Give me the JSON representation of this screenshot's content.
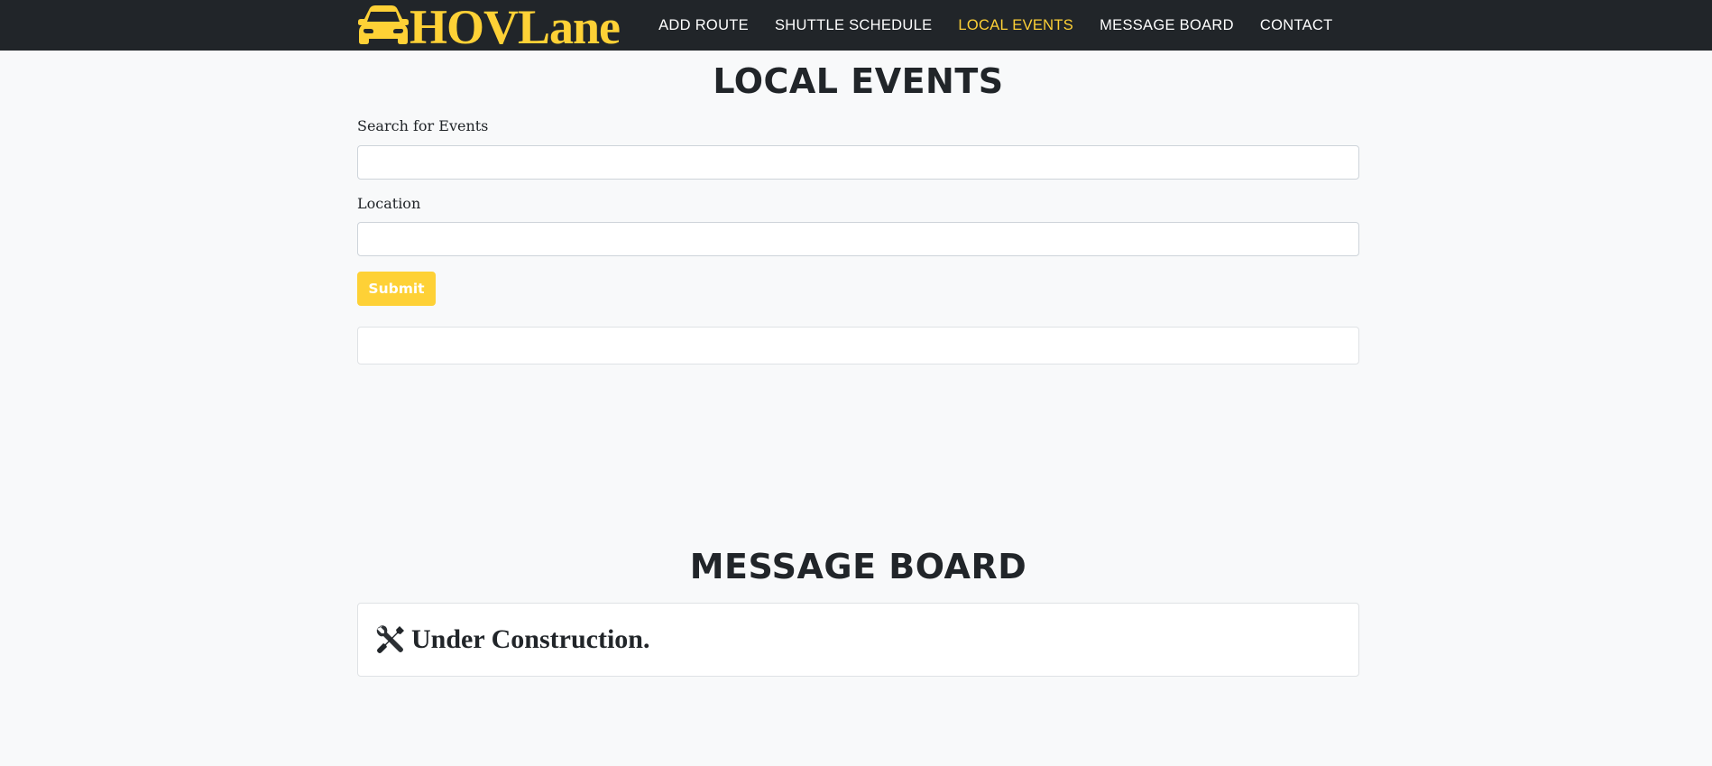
{
  "brand": {
    "name": "HOVLane",
    "icon": "car-icon",
    "color": "#fed136"
  },
  "nav": {
    "items": [
      {
        "label": "ADD ROUTE",
        "active": false
      },
      {
        "label": "SHUTTLE SCHEDULE",
        "active": false
      },
      {
        "label": "LOCAL EVENTS",
        "active": true
      },
      {
        "label": "MESSAGE BOARD",
        "active": false
      },
      {
        "label": "CONTACT",
        "active": false
      }
    ]
  },
  "events": {
    "title": "LOCAL EVENTS",
    "search_label": "Search for Events",
    "search_value": "",
    "location_label": "Location",
    "location_value": "",
    "submit_label": "Submit"
  },
  "message_board": {
    "title": "MESSAGE BOARD",
    "notice_icon": "tools-icon",
    "notice_text": "Under Construction."
  },
  "colors": {
    "navbar_bg": "#212529",
    "accent": "#fed136",
    "page_bg": "#f8f9fa",
    "text": "#212529"
  }
}
